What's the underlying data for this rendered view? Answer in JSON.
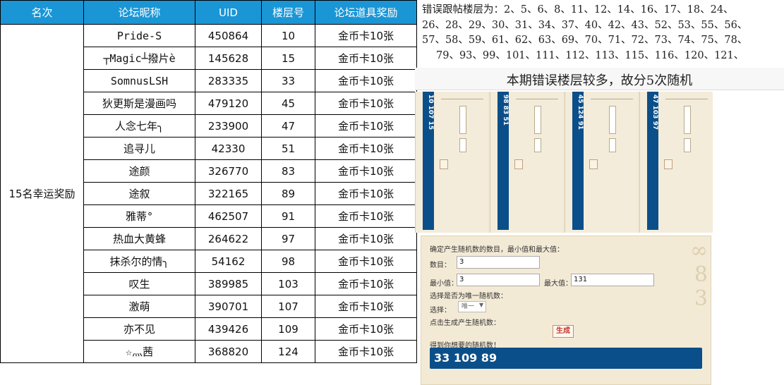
{
  "table": {
    "headers": [
      "名次",
      "论坛昵称",
      "UID",
      "楼层号",
      "论坛道具奖励"
    ],
    "rank_label": "15名幸运奖励",
    "rows": [
      {
        "nick": "Pride-S",
        "uid": "450864",
        "floor": "10",
        "reward": "金币卡10张"
      },
      {
        "nick": "┬Magic┴撥片è",
        "uid": "145628",
        "floor": "15",
        "reward": "金币卡10张"
      },
      {
        "nick": "SomnusLSH",
        "uid": "283335",
        "floor": "33",
        "reward": "金币卡10张"
      },
      {
        "nick": "狄更斯是漫画吗",
        "uid": "479120",
        "floor": "45",
        "reward": "金币卡10张"
      },
      {
        "nick": "人念七年╮",
        "uid": "233900",
        "floor": "47",
        "reward": "金币卡10张"
      },
      {
        "nick": "追寻儿",
        "uid": "42330",
        "floor": "51",
        "reward": "金币卡10张"
      },
      {
        "nick": "途颜",
        "uid": "326770",
        "floor": "83",
        "reward": "金币卡10张"
      },
      {
        "nick": "途叙",
        "uid": "322165",
        "floor": "89",
        "reward": "金币卡10张"
      },
      {
        "nick": "雅蒂°",
        "uid": "462507",
        "floor": "91",
        "reward": "金币卡10张"
      },
      {
        "nick": "热血大黄蜂",
        "uid": "264622",
        "floor": "97",
        "reward": "金币卡10张"
      },
      {
        "nick": "抹杀尔的情╮",
        "uid": "54162",
        "floor": "98",
        "reward": "金币卡10张"
      },
      {
        "nick": "叹生",
        "uid": "389985",
        "floor": "103",
        "reward": "金币卡10张"
      },
      {
        "nick": "激萌",
        "uid": "390701",
        "floor": "107",
        "reward": "金币卡10张"
      },
      {
        "nick": "亦不见",
        "uid": "439426",
        "floor": "109",
        "reward": "金币卡10张"
      },
      {
        "nick": "☆灬茜",
        "uid": "368820",
        "floor": "124",
        "reward": "金币卡10张"
      }
    ]
  },
  "floors_text": {
    "line1": "错误跟帖楼层为：2、5、6、8、11、12、14、16、17、18、24、",
    "line2": "26、28、29、30、31、34、37、40、42、43、52、53、55、56、",
    "line3": "57、58、59、61、62、63、69、70、71、72、73、74、75、78、",
    "line4": "79、93、99、101、111、112、113、115、116、120、121、"
  },
  "note": "本期错误楼层较多，故分5次随机",
  "thumbnails": [
    {
      "numbers": "10 107 15"
    },
    {
      "numbers": "98 83 51"
    },
    {
      "numbers": "45 124 91"
    },
    {
      "numbers": "47 103 97"
    }
  ],
  "generator": {
    "prompt": "确定产生随机数的数目，最小值和最大值：",
    "count_label": "数目：",
    "count_value": "3",
    "min_label": "最小值：",
    "min_value": "3",
    "max_label": "最大值：",
    "max_value": "131",
    "unique_label": "选择是否为唯一随机数：",
    "select_label": "选择：",
    "select_value": "唯一",
    "click_label": "点击生成产生随机数：",
    "generate_button": "生成",
    "result_label": "得到你想要的随机数！",
    "result_value": "33  109  89"
  },
  "colors": {
    "header_bg": "#1a96d6",
    "result_bg": "#0b4f8a",
    "panel_bg": "#f3ead6"
  }
}
